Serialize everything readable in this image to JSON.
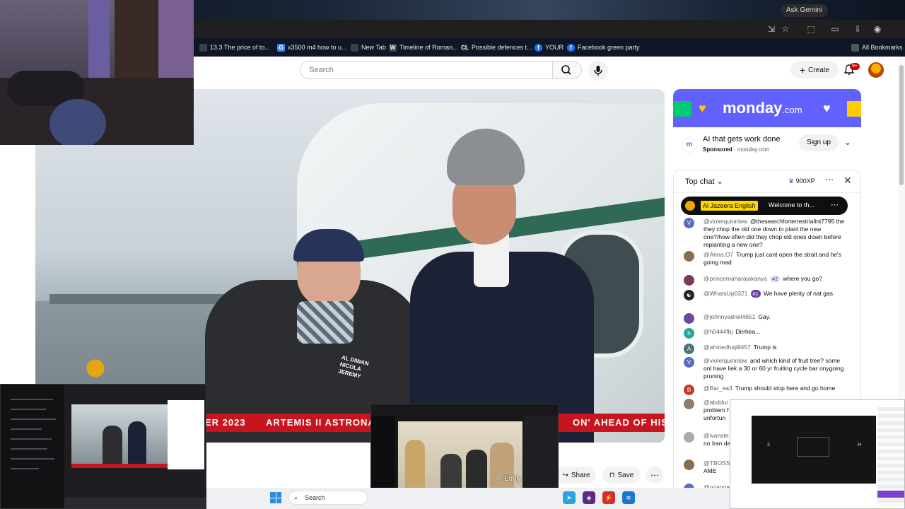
{
  "browser": {
    "gemini_label": "Ask Gemini",
    "bookmarks": [
      {
        "label": "13.3 The price of to...",
        "icon": "page-icon",
        "color": "#3a3f4a"
      },
      {
        "label": "x3500 m4 how to u...",
        "icon": "google-icon",
        "color": "#4285f4"
      },
      {
        "label": "New Tab",
        "icon": "newtab-icon",
        "color": "#3a3f4a"
      },
      {
        "label": "Timeline of Roman...",
        "icon": "wikipedia-icon",
        "color": "#444"
      },
      {
        "label": "Possible defences t...",
        "icon": "cl-icon",
        "color": "#222"
      },
      {
        "label": "YOUR",
        "icon": "facebook-icon",
        "color": "#1877f2"
      },
      {
        "label": "Facebook green party",
        "icon": "facebook-icon",
        "color": "#1877f2"
      }
    ],
    "all_bookmarks_label": "All Bookmarks"
  },
  "youtube": {
    "search_placeholder": "Search",
    "create_label": "Create",
    "notif_badge": "9+",
    "video": {
      "ticker_1": "ER 2023",
      "ticker_2": "ARTEMIS II ASTRONA",
      "ticker_3": "ON' AHEAD OF HISTOR",
      "jacket_text": "AL DIWAN NICOLA JEREMY"
    },
    "actions": {
      "share": "Share",
      "save": "Save"
    },
    "ad": {
      "brand": "monday",
      "brand_suffix": ".com",
      "title": "AI that gets work done",
      "sponsored": "Sponsored",
      "domain": "· monday.com",
      "signup": "Sign up"
    },
    "chat": {
      "header": "Top chat",
      "xp": "900XP",
      "pinned_author": "Al Jazeera English",
      "pinned_text": "Welcome to th...",
      "messages": [
        {
          "author": "@violetquinnlaw",
          "text": "@thesearchforterrestrialint7795 the they chop the old one down to plant the new one?/how often did they chop old ones down before replanting a new one?",
          "avatar": "V",
          "color": "#5b6bc0"
        },
        {
          "author": "@Anna.O7",
          "text": "Trump just cant open the strait and he's going mad",
          "avatar": "",
          "color": "#8a6d4a"
        },
        {
          "author": "@princemaharajakanya",
          "tag": "#2",
          "text": "where you go?",
          "avatar": "",
          "color": "#7a3a5a"
        },
        {
          "author": "@WhatsUp0321",
          "tag": "#1",
          "text": "We have plenty of nat gas",
          "avatar": "☯",
          "color": "#222"
        },
        {
          "author": "@johnnyadriel4651",
          "text": "Gay.",
          "avatar": "",
          "color": "#6a4aa0"
        },
        {
          "author": "@h0444fbj",
          "text": "Dirrhea...",
          "avatar": "h",
          "color": "#26a69a"
        },
        {
          "author": "@ahmedhaji9457",
          "text": "Trump is",
          "avatar": "A",
          "color": "#546e7a"
        },
        {
          "author": "@violetquinnlaw",
          "text": "and which kind of fruit tree? some onl have liek a 30 or 60 yr fruiting cycle bar onygoing pruning",
          "avatar": "V",
          "color": "#5b6bc0"
        },
        {
          "author": "@Bar_ea3",
          "text": "Trump should stop here and go home",
          "avatar": "B",
          "color": "#c0392b"
        },
        {
          "author": "@abddur",
          "text": "extremel problem f unfortun",
          "avatar": "",
          "color": "#8e7d6a"
        },
        {
          "author": "@ivanste",
          "text": "there's no Iran dare",
          "avatar": "",
          "color": "#aaa"
        },
        {
          "author": "@TBOSSI",
          "text": "AND AME",
          "avatar": "",
          "color": "#8a6d4a"
        },
        {
          "author": "@nganga",
          "text": "",
          "avatar": "",
          "color": "#5b6bc0"
        }
      ]
    }
  },
  "thumbnails": {
    "emily_label": "Emily"
  },
  "taskbar": {
    "search_label": "Search"
  }
}
